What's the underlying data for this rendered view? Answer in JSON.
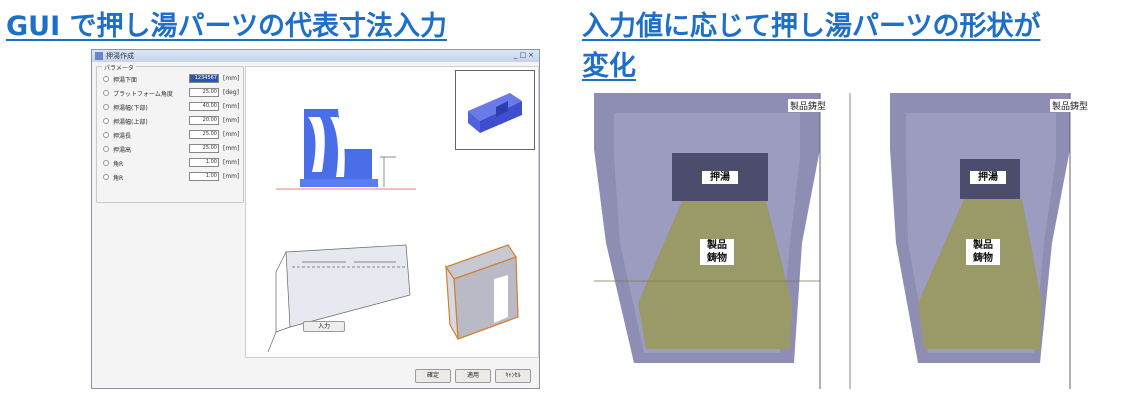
{
  "headings": {
    "left": "GUI で押し湯パーツの代表寸法入力",
    "right_line1": "入力値に応じて押し湯パーツの形状が",
    "right_line2": "変化"
  },
  "dialog": {
    "title": "押湯作成",
    "window_controls": "_□×",
    "params_legend": "パラメータ",
    "params": [
      {
        "label": "押湯下面",
        "value": "1234567",
        "unit": "[mm]",
        "selected": true
      },
      {
        "label": "プラットフォーム角度",
        "value": "25.00",
        "unit": "[deg]"
      },
      {
        "label": "押湯幅(下部)",
        "value": "40.00",
        "unit": "[mm]"
      },
      {
        "label": "押湯幅(上部)",
        "value": "20.00",
        "unit": "[mm]"
      },
      {
        "label": "押湯長",
        "value": "25.00",
        "unit": "[mm]"
      },
      {
        "label": "押湯高",
        "value": "25.00",
        "unit": "[mm]"
      },
      {
        "label": "角R",
        "value": "1.00",
        "unit": "[mm]"
      },
      {
        "label": "角R",
        "value": "1.00",
        "unit": "[mm]"
      }
    ],
    "input_button": "入力",
    "buttons": {
      "ok": "確定",
      "apply": "適用",
      "cancel": "ｷｬﾝｾﾙ"
    }
  },
  "panels": {
    "mold_label": "製品鋳型",
    "riser_label": "押湯",
    "casting_label_line1": "製品",
    "casting_label_line2": "鋳物"
  },
  "colors": {
    "heading": "#1e6fc8",
    "mold": "#8e8eb4",
    "riser": "#4c4c6c",
    "casting": "#9a9a68",
    "part_blue": "#4a6ee8"
  }
}
